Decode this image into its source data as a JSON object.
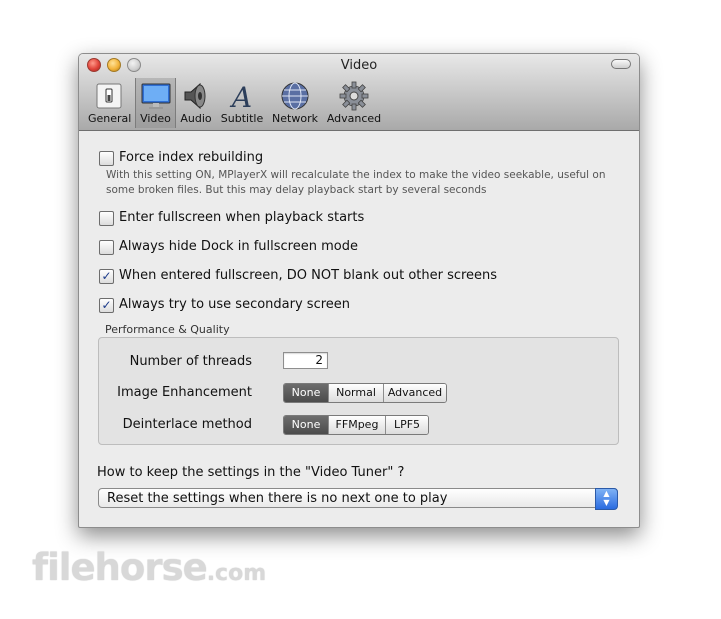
{
  "window": {
    "title": "Video"
  },
  "toolbar": {
    "tabs": [
      {
        "label": "General",
        "icon": "switch-icon"
      },
      {
        "label": "Video",
        "icon": "monitor-icon",
        "selected": true
      },
      {
        "label": "Audio",
        "icon": "speaker-icon"
      },
      {
        "label": "Subtitle",
        "icon": "letter-a-icon"
      },
      {
        "label": "Network",
        "icon": "globe-icon"
      },
      {
        "label": "Advanced",
        "icon": "gear-icon"
      }
    ]
  },
  "options": {
    "force_index": {
      "label": "Force index rebuilding",
      "checked": false,
      "note": "With this setting ON, MPlayerX will recalculate the index to make the video seekable, useful on some broken files. But this may delay playback start by several seconds"
    },
    "enter_fullscreen": {
      "label": "Enter fullscreen when playback starts",
      "checked": false
    },
    "hide_dock": {
      "label": "Always hide Dock in fullscreen mode",
      "checked": false
    },
    "no_blank": {
      "label": "When entered fullscreen, DO NOT blank out other screens",
      "checked": true
    },
    "secondary_screen": {
      "label": "Always try to use secondary screen",
      "checked": true
    }
  },
  "performance": {
    "group_label": "Performance & Quality",
    "threads_label": "Number of threads",
    "threads_value": "2",
    "enhancement_label": "Image Enhancement",
    "enhancement_options": [
      "None",
      "Normal",
      "Advanced"
    ],
    "enhancement_selected": "None",
    "deinterlace_label": "Deinterlace method",
    "deinterlace_options": [
      "None",
      "FFMpeg",
      "LPF5"
    ],
    "deinterlace_selected": "None"
  },
  "tuner": {
    "question": "How to keep the settings in the \"Video Tuner\" ?",
    "selected": "Reset the settings when there is no next one to play"
  },
  "watermark": {
    "text": "filehorse",
    "suffix": ".com"
  },
  "colors": {
    "accent": "#2a6be0",
    "selected_segment": "#4b4b4b",
    "check": "#1b3a8a"
  }
}
